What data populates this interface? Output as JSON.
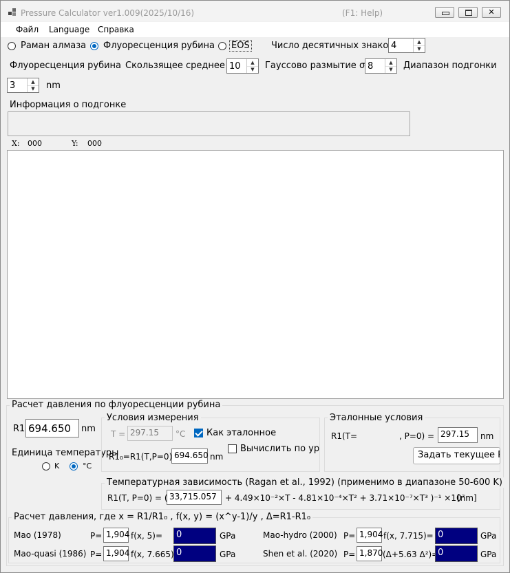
{
  "window": {
    "title": "Pressure Calculator  ver1.009(2025/10/16)",
    "help_hint": "(F1: Help)",
    "buttons": {
      "minimize": "▭",
      "maximize": "▢",
      "close": "✕"
    }
  },
  "menu": {
    "file": "Файл",
    "language": "Language",
    "help": "Справка"
  },
  "mode": {
    "diamond_raman": "Раман алмаза",
    "ruby_fluorescence": "Флуоресценция рубина",
    "eos": "EOS",
    "selected": "ruby_fluorescence",
    "decimals_label": "Число десятичных знаков",
    "decimals_value": "4"
  },
  "ruby_settings": {
    "section_label": "Флуоресценция рубина",
    "moving_avg_label": "Скользящее среднее",
    "moving_avg_value": "10",
    "gauss_label": "Гауссово размытие σ",
    "gauss_value": "8",
    "fit_range_label": "Диапазон подгонки",
    "fit_range_value": "3",
    "fit_range_unit": "nm"
  },
  "fit_info": {
    "label": "Информация о подгонке",
    "text": ""
  },
  "cursor": {
    "x_label": "X:",
    "x_value": "000",
    "y_label": "Y:",
    "y_value": "000"
  },
  "ruby_calc": {
    "group_title": "Расчет давления по флуоресценции рубина",
    "r1_label": "R1",
    "r1_value": "694.650",
    "r1_unit": "nm",
    "temp_unit_label": "Единица температуры",
    "unit_k": "K",
    "unit_c": "°C",
    "unit_selected": "C",
    "meas": {
      "title": "Условия измерения",
      "t_label": "T =",
      "t_value": "297.15",
      "t_unit": "°C",
      "as_reference": "Как эталонное",
      "as_reference_checked": true,
      "r10_label": "R1₀=R1(T,P=0)",
      "r10_value": "694.650",
      "r10_unit": "nm",
      "compute_label": "Вычислить по ура",
      "compute_checked": false
    },
    "ref": {
      "title": "Эталонные условия",
      "r1t_label": "R1(T=",
      "p0_label": ", P=0) =",
      "r1t_value": "297.15",
      "unit": "nm",
      "set_current_button": "Задать текущее R"
    },
    "temp_dep": {
      "title": "Температурная зависимость (Ragan et al., 1992) (применимо в диапазоне 50-600 K)",
      "prefix": "R1(T, P=0) = (",
      "value": "33,715.057",
      "formula": "+ 4.49×10⁻²×T - 4.81×10⁻⁴×T² + 3.71×10⁻⁷×T³ )⁻¹ ×10⁷",
      "unit": "[nm]"
    }
  },
  "pressure_calc": {
    "title": "Расчет давления, где x = R1/R1₀ ,  f(x, y) = (x^y-1)/y ,  Δ=R1-R1₀",
    "rows": [
      {
        "name": "Mao (1978)",
        "p_label": "P=",
        "coef": "1,904",
        "func": "f(x, 5)=",
        "result": "0",
        "unit": "GPa"
      },
      {
        "name": "Mao-hydro (2000)",
        "p_label": "P=",
        "coef": "1,904",
        "func": "f(x, 7.715)=",
        "result": "0",
        "unit": "GPa"
      },
      {
        "name": "Mao-quasi (1986)",
        "p_label": "P=",
        "coef": "1,904",
        "func": "f(x, 7.665)=",
        "result": "0",
        "unit": "GPa"
      },
      {
        "name": "Shen et al. (2020)",
        "p_label": "P=",
        "coef": "1,870",
        "func": "(Δ+5.63 Δ²)=",
        "result": "0",
        "unit": "GPa"
      }
    ]
  },
  "colors": {
    "result_bg": "#000080",
    "accent": "#0067c0"
  }
}
